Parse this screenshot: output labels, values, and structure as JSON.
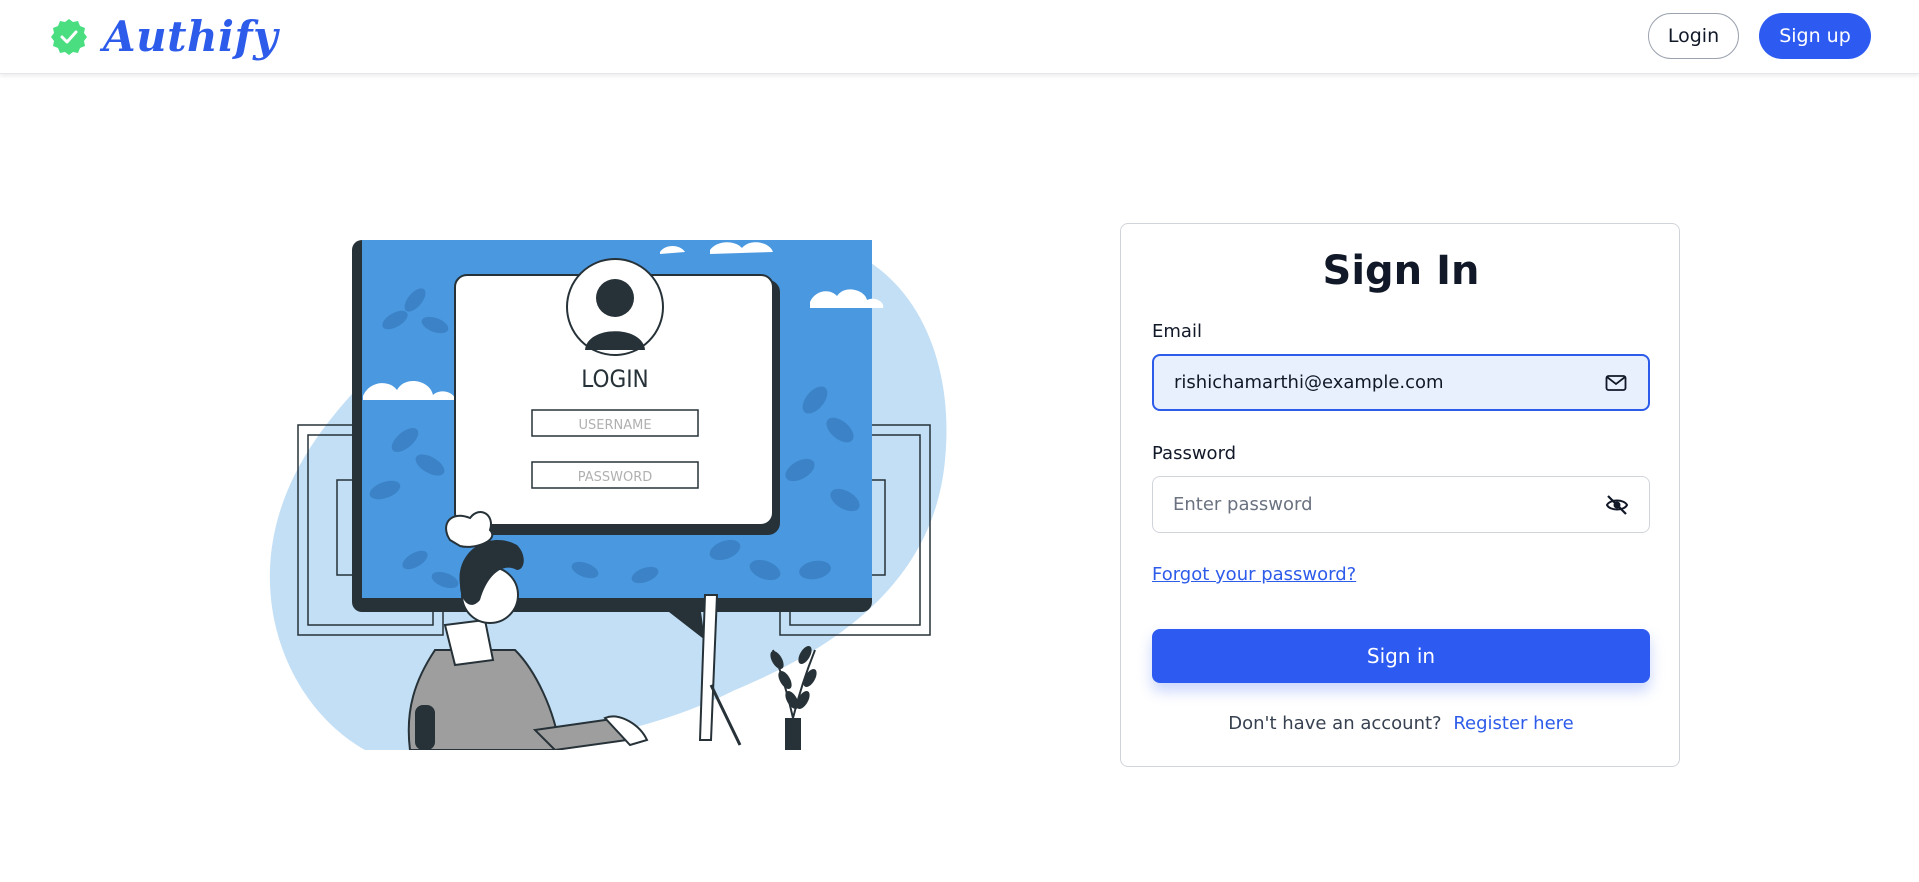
{
  "header": {
    "brand_name": "Authify",
    "login_label": "Login",
    "signup_label": "Sign up"
  },
  "illustration": {
    "login_title": "LOGIN",
    "username_placeholder": "USERNAME",
    "password_placeholder": "PASSWORD"
  },
  "form": {
    "title": "Sign In",
    "email_label": "Email",
    "email_value": "rishichamarthi@example.com",
    "password_label": "Password",
    "password_placeholder": "Enter password",
    "forgot_label": "Forgot your password?",
    "submit_label": "Sign in",
    "no_account_text": "Don't have an account?",
    "register_label": "Register here"
  },
  "colors": {
    "accent": "#2d5bf2",
    "brand": "#2d5bea",
    "badge": "#4ade80",
    "illustration_blue": "#4a98e0",
    "illustration_light": "#c3dff5"
  },
  "icons": {
    "brand": "check-badge-icon",
    "email": "mail-icon",
    "password": "eye-off-icon"
  }
}
